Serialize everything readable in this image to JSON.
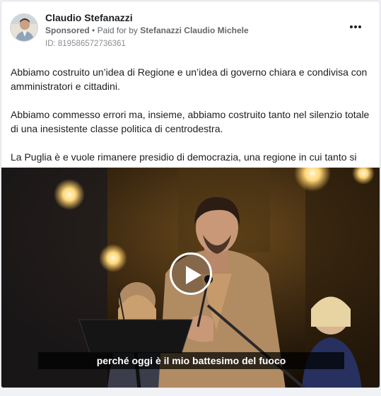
{
  "post": {
    "author": "Claudio Stefanazzi",
    "sponsored": "Sponsored",
    "separator": "•",
    "paid_for_label": "Paid for by",
    "payer": "Stefanazzi Claudio Michele",
    "ad_id": "ID: 819586572736361",
    "more_icon": "more-horizontal-icon",
    "paragraphs": [
      "Abbiamo costruito un’idea di Regione e un’idea di governo chiara e condivisa con amministratori e cittadini.",
      "Abbiamo commesso errori ma, insieme, abbiamo costruito tanto nel silenzio totale di una inesistente classe politica di centrodestra.",
      "La Puglia è e vuole rimanere presidio di democrazia, una regione in cui tanto si è…"
    ]
  },
  "video": {
    "subtitle": "perché oggi è il mio battesimo del fuoco",
    "play_icon": "play-icon"
  },
  "colors": {
    "text": "#1c1e21",
    "secondary": "#65676b",
    "card_border": "#dddfe2",
    "background": "#f0f2f5"
  }
}
